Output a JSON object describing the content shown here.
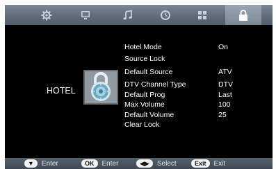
{
  "tabs": [
    {
      "icon": "gear-icon"
    },
    {
      "icon": "monitor-icon"
    },
    {
      "icon": "music-note-icon"
    },
    {
      "icon": "clock-icon"
    },
    {
      "icon": "grid-icon"
    },
    {
      "icon": "lock-icon",
      "selected": true
    }
  ],
  "side": {
    "title": "HOTEL"
  },
  "menu": {
    "items": [
      {
        "label": "Hotel Mode",
        "value": "On"
      },
      {
        "label": "Source Lock",
        "value": ""
      },
      {
        "label": "Default Source",
        "value": "ATV"
      },
      {
        "label": "DTV Channel Type",
        "value": "DTV"
      },
      {
        "label": "Default Prog",
        "value": "Last"
      },
      {
        "label": "Max Volume",
        "value": "100"
      },
      {
        "label": "Default Volume",
        "value": "25"
      },
      {
        "label": "Clear Lock",
        "value": ""
      }
    ]
  },
  "footer": {
    "hints": [
      {
        "key": "▼",
        "text": "Enter"
      },
      {
        "key": "OK",
        "text": "Enter"
      },
      {
        "key": "◀▶",
        "text": "Select"
      },
      {
        "key": "Exit",
        "text": "Exit"
      }
    ]
  }
}
